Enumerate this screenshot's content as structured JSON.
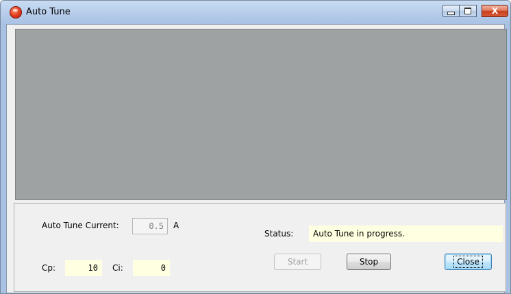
{
  "window": {
    "title": "Auto Tune",
    "icon": "app-logo-icon",
    "controls": {
      "minimize": "",
      "maximize": "",
      "close": "X"
    }
  },
  "plot": {
    "background": "#9ea2a3"
  },
  "form": {
    "auto_tune_current_label": "Auto Tune Current:",
    "auto_tune_current_value": "0.5",
    "auto_tune_current_unit": "A",
    "status_label": "Status:",
    "status_value": "Auto Tune in progress.",
    "cp_label": "Cp:",
    "cp_value": "10",
    "ci_label": "Ci:",
    "ci_value": "0"
  },
  "buttons": {
    "start": "Start",
    "stop": "Stop",
    "close": "Close"
  },
  "colors": {
    "field_highlight": "#ffffe1",
    "panel_background": "#f0f0f0"
  }
}
